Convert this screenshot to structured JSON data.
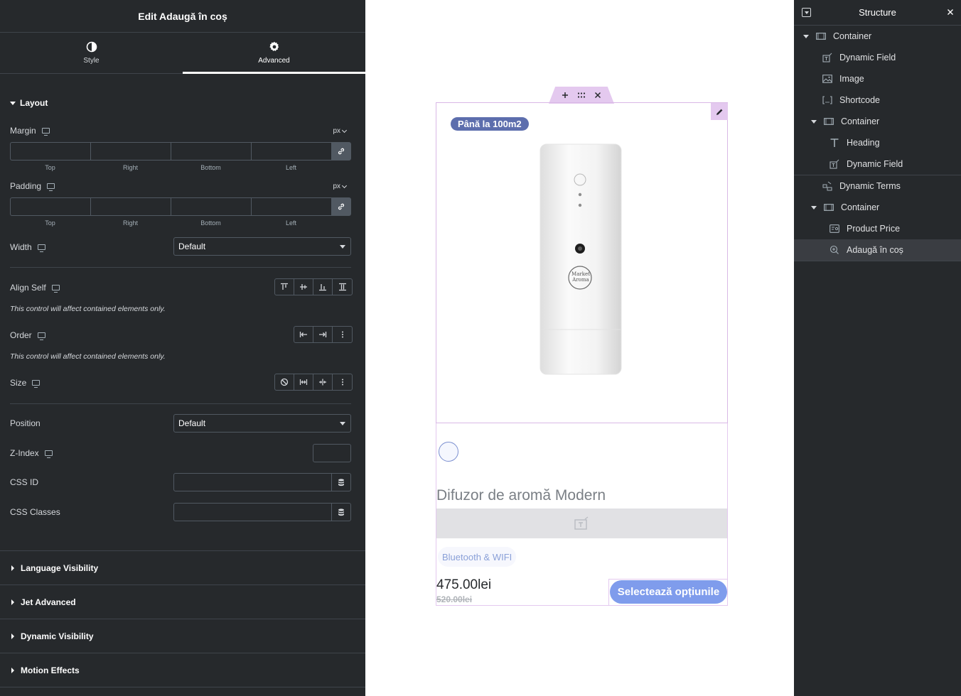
{
  "editor": {
    "title": "Edit Adaugă în coș",
    "tabs": [
      {
        "label": "Style",
        "icon": "half-circle-icon",
        "active": false
      },
      {
        "label": "Advanced",
        "icon": "gear-icon",
        "active": true
      }
    ],
    "layout": {
      "title": "Layout",
      "margin": {
        "label": "Margin",
        "unit": "px",
        "top": "",
        "right": "",
        "bottom": "",
        "left": ""
      },
      "padding": {
        "label": "Padding",
        "unit": "px",
        "top": "",
        "right": "",
        "bottom": "",
        "left": ""
      },
      "side_labels": [
        "Top",
        "Right",
        "Bottom",
        "Left"
      ],
      "width": {
        "label": "Width",
        "value": "Default"
      },
      "align_self": {
        "label": "Align Self",
        "note": "This control will affect contained elements only."
      },
      "order": {
        "label": "Order",
        "note": "This control will affect contained elements only."
      },
      "size": {
        "label": "Size"
      },
      "position": {
        "label": "Position",
        "value": "Default"
      },
      "z_index": {
        "label": "Z-Index",
        "value": ""
      },
      "css_id": {
        "label": "CSS ID",
        "value": ""
      },
      "css_classes": {
        "label": "CSS Classes",
        "value": ""
      }
    },
    "sections": [
      "Language Visibility",
      "Jet Advanced",
      "Dynamic Visibility",
      "Motion Effects"
    ]
  },
  "canvas": {
    "badge": "Până la 100m2",
    "product_title": "Difuzor de aromă Modern",
    "tag": "Bluetooth & WIFI",
    "price": "475.00lei",
    "old_price": "520.00lei",
    "cta": "Selectează opțiunile",
    "logo_text": "Market Aroma"
  },
  "structure": {
    "title": "Structure",
    "items": [
      {
        "label": "Container",
        "icon": "container-icon",
        "level": 0,
        "expanded": true
      },
      {
        "label": "Dynamic Field",
        "icon": "dynamic-field-icon",
        "level": 1
      },
      {
        "label": "Image",
        "icon": "image-icon",
        "level": 1
      },
      {
        "label": "Shortcode",
        "icon": "shortcode-icon",
        "level": 1
      },
      {
        "label": "Container",
        "icon": "container-icon",
        "level": 1,
        "expanded": true
      },
      {
        "label": "Heading",
        "icon": "heading-icon",
        "level": 2
      },
      {
        "label": "Dynamic Field",
        "icon": "dynamic-field-icon",
        "level": 2
      },
      {
        "label": "Dynamic Terms",
        "icon": "dynamic-terms-icon",
        "level": 1
      },
      {
        "label": "Container",
        "icon": "container-icon",
        "level": 1,
        "expanded": true
      },
      {
        "label": "Product Price",
        "icon": "product-price-icon",
        "level": 2
      },
      {
        "label": "Adaugă în coș",
        "icon": "add-to-cart-icon",
        "level": 2,
        "selected": true
      }
    ]
  },
  "colors": {
    "panel_bg": "#26292c",
    "accent_pink": "#e4c9ef",
    "badge_bg": "#5d6ead",
    "cta_bg": "#7f9cec"
  }
}
